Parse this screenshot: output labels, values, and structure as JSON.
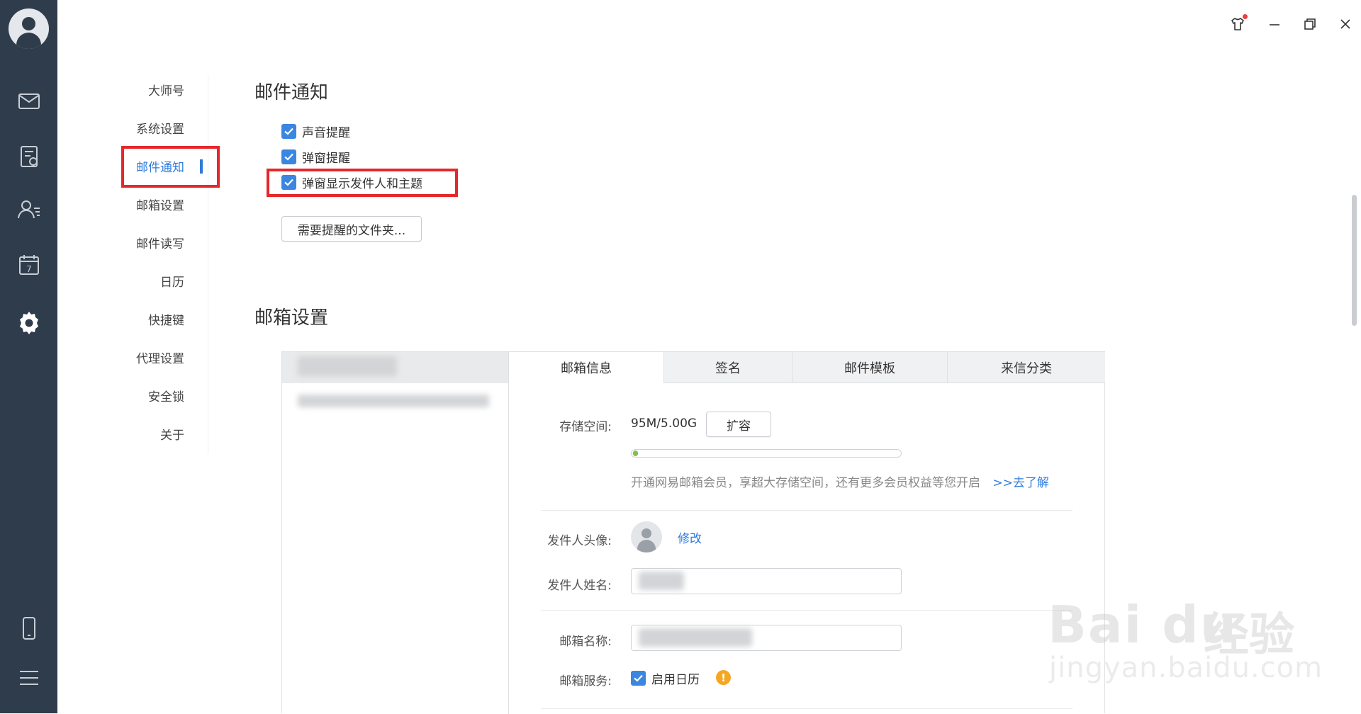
{
  "rail": {
    "icons": [
      "avatar",
      "mail-icon",
      "notes-icon",
      "contacts-icon",
      "calendar-icon",
      "settings-gear-icon",
      "phone-icon",
      "menu-icon"
    ],
    "calendar_day": "7"
  },
  "window_controls": [
    "skin-tshirt-icon",
    "minimize-icon",
    "restore-icon",
    "close-icon"
  ],
  "nav": {
    "items": [
      {
        "label": "大师号"
      },
      {
        "label": "系统设置"
      },
      {
        "label": "邮件通知"
      },
      {
        "label": "邮箱设置"
      },
      {
        "label": "邮件读写"
      },
      {
        "label": "日历"
      },
      {
        "label": "快捷键"
      },
      {
        "label": "代理设置"
      },
      {
        "label": "安全锁"
      },
      {
        "label": "关于"
      }
    ],
    "active": "邮件通知"
  },
  "notify": {
    "title": "邮件通知",
    "options": [
      {
        "label": "声音提醒",
        "checked": true
      },
      {
        "label": "弹窗提醒",
        "checked": true
      },
      {
        "label": "弹窗显示发件人和主题",
        "checked": true
      }
    ],
    "folder_button": "需要提醒的文件夹..."
  },
  "mailbox": {
    "title": "邮箱设置",
    "tabs": [
      {
        "label": "邮箱信息",
        "active": true
      },
      {
        "label": "签名",
        "active": false
      },
      {
        "label": "邮件模板",
        "active": false
      },
      {
        "label": "来信分类",
        "active": false
      }
    ],
    "storage_label": "存储空间:",
    "storage_value": "95M/5.00G",
    "storage_used_fraction": 0.019,
    "expand_button": "扩容",
    "promo_text": "开通网易邮箱会员，享超大存储空间，还有更多会员权益等您开启",
    "promo_link": ">>去了解",
    "avatar_label": "发件人头像:",
    "avatar_modify": "修改",
    "sender_name_label": "发件人姓名:",
    "mailbox_name_label": "邮箱名称:",
    "service_label": "邮箱服务:",
    "calendar_option": "启用日历",
    "calendar_checked": true,
    "warn_symbol": "!"
  },
  "colors": {
    "rail_bg": "#2f3c4b",
    "accent": "#2f7bdb",
    "highlight_box": "#e5282b",
    "checkbox": "#3a86e0"
  },
  "watermark": {
    "logo": "Bai du",
    "cn": "经验",
    "url": "jingyan.baidu.com"
  }
}
